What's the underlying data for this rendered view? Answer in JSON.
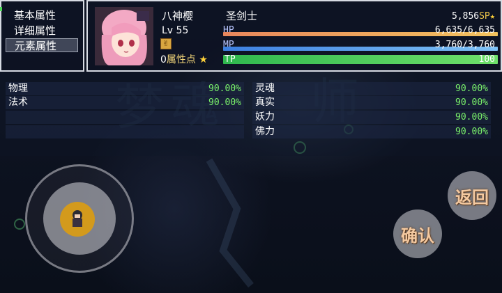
{
  "menu": {
    "items": [
      "基本属性",
      "详细属性",
      "元素属性"
    ],
    "selected_index": 2
  },
  "actor": {
    "name": "八神樱",
    "level_label": "Lv",
    "level": "55",
    "class": "圣剑士",
    "sp": "5,856",
    "sp_label": "SP",
    "attribute_points": "0",
    "attribute_points_label": "属性点"
  },
  "gauges": {
    "hp": {
      "label": "HP",
      "current": "6,635",
      "max": "6,635",
      "fill_ratio": 1.0,
      "color": "#f0a05c"
    },
    "mp": {
      "label": "MP",
      "current": "3,760",
      "max": "3,760",
      "fill_ratio": 1.0,
      "color": "#4a8fe6"
    },
    "tp": {
      "label": "TP",
      "current": "100",
      "fill_ratio": 1.0,
      "color": "#3fcf5a"
    }
  },
  "elements": {
    "left": [
      {
        "name": "物理",
        "value": "90.00%"
      },
      {
        "name": "法术",
        "value": "90.00%"
      }
    ],
    "right": [
      {
        "name": "灵魂",
        "value": "90.00%"
      },
      {
        "name": "真实",
        "value": "90.00%"
      },
      {
        "name": "妖力",
        "value": "90.00%"
      },
      {
        "name": "佛力",
        "value": "90.00%"
      }
    ]
  },
  "buttons": {
    "back": "返回",
    "confirm": "确认"
  },
  "colors": {
    "value_green": "#7bf36b",
    "window_border": "#d7dbe3",
    "sp_gold": "#f2c84a"
  }
}
